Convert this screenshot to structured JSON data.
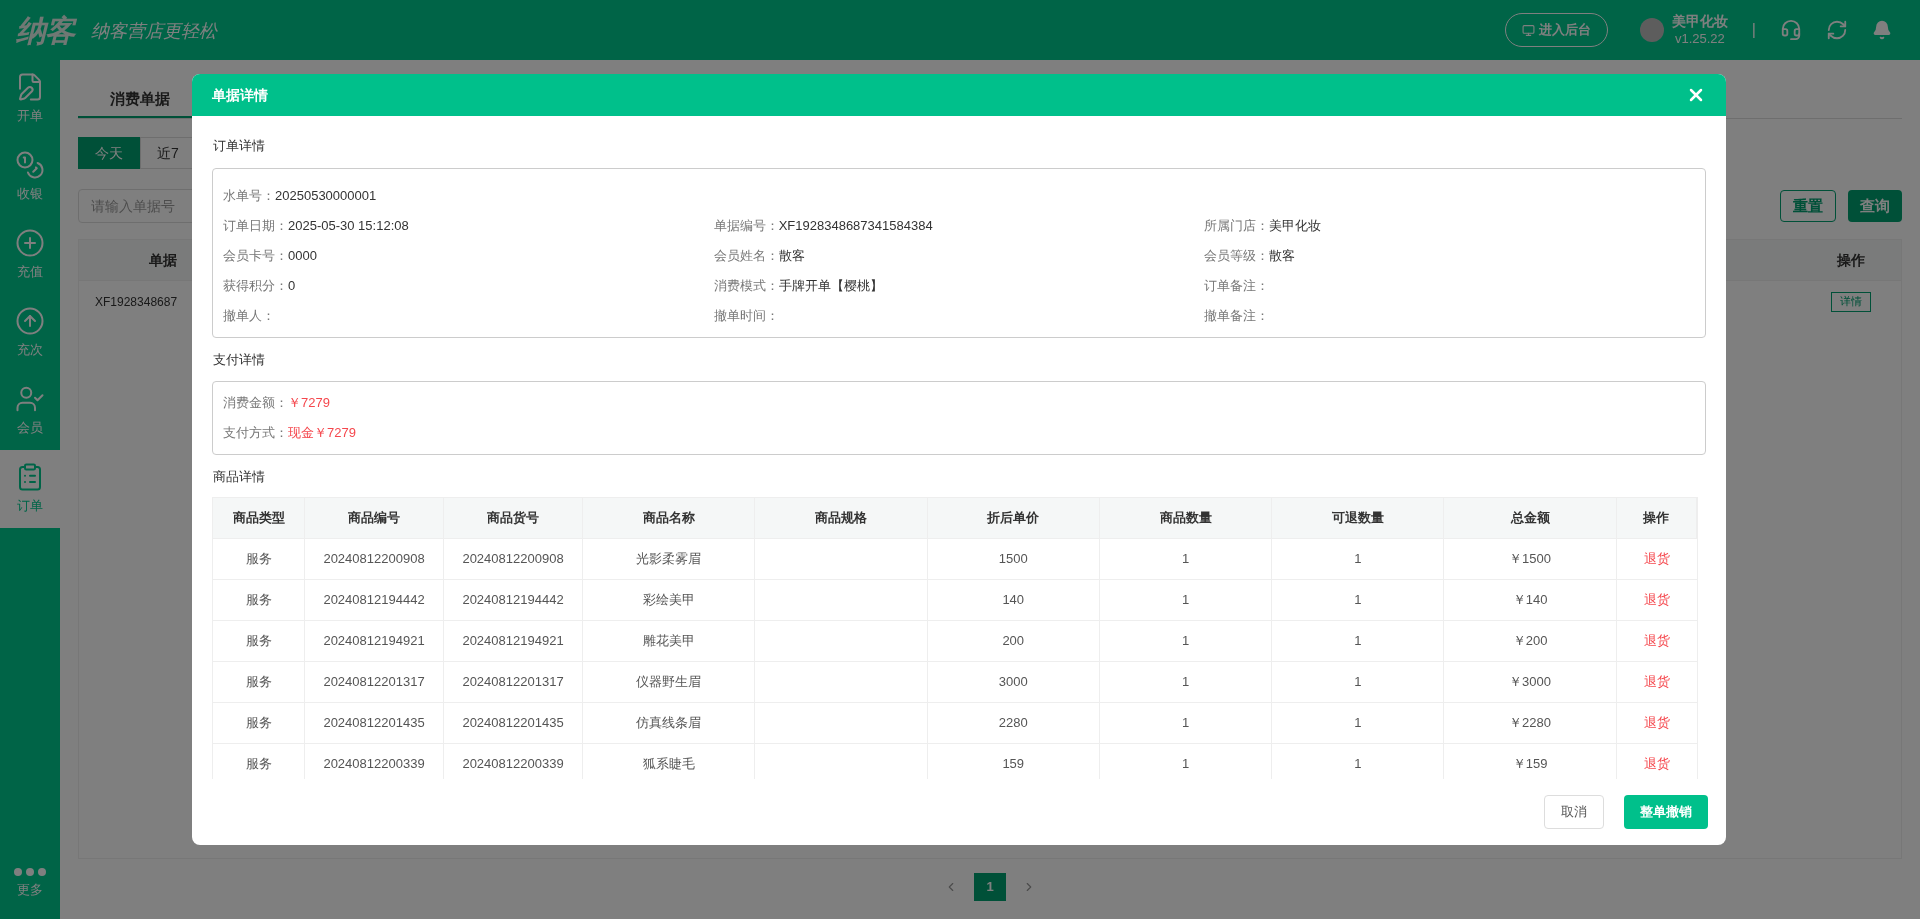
{
  "header": {
    "logo": "纳客",
    "slogan": "纳客营店更轻松",
    "admin_button": "进入后台",
    "store_name": "美甲化妆",
    "version": "v1.25.22",
    "separator": "|"
  },
  "sidebar": {
    "items": [
      {
        "label": "开单",
        "selected": false
      },
      {
        "label": "收银",
        "selected": false
      },
      {
        "label": "充值",
        "selected": false
      },
      {
        "label": "充次",
        "selected": false
      },
      {
        "label": "会员",
        "selected": false
      },
      {
        "label": "订单",
        "selected": true
      }
    ],
    "more": "更多"
  },
  "page": {
    "tabs": [
      {
        "label": "消费单据",
        "selected": true
      }
    ],
    "date_filters": [
      {
        "label": "今天",
        "selected": true
      },
      {
        "label": "近7",
        "selected": false
      }
    ],
    "search": {
      "placeholder": "请输入单据号"
    },
    "reset_button": "重置",
    "query_button": "查询",
    "table": {
      "columns": [
        "单据",
        "操作"
      ],
      "rows": [
        {
          "cells": [
            "XF1928348687"
          ],
          "action": "详情"
        }
      ]
    },
    "pagination": {
      "pages": [
        {
          "label": "1",
          "selected": true
        }
      ]
    }
  },
  "dialog": {
    "title": "单据详情",
    "order_section": {
      "title": "订单详情",
      "serial": {
        "label": "水单号：",
        "value": "20250530000001"
      },
      "fields": [
        {
          "label": "订单日期：",
          "value": "2025-05-30 15:12:08"
        },
        {
          "label": "单据编号：",
          "value": "XF1928348687341584384"
        },
        {
          "label": "所属门店：",
          "value": "美甲化妆"
        },
        {
          "label": "会员卡号：",
          "value": "0000"
        },
        {
          "label": "会员姓名：",
          "value": "散客"
        },
        {
          "label": "会员等级：",
          "value": "散客"
        },
        {
          "label": "获得积分：",
          "value": "0"
        },
        {
          "label": "消费模式：",
          "value": "手牌开单【樱桃】"
        },
        {
          "label": "订单备注："
        },
        {
          "label": "撤单人："
        },
        {
          "label": "撤单时间："
        },
        {
          "label": "撤单备注："
        }
      ]
    },
    "payment_section": {
      "title": "支付详情",
      "fields": [
        {
          "label": "消费金额：",
          "value": "￥7279"
        },
        {
          "label": "支付方式：",
          "value": "现金￥7279"
        }
      ]
    },
    "goods_section": {
      "title": "商品详情",
      "columns": [
        "商品类型",
        "商品编号",
        "商品货号",
        "商品名称",
        "商品规格",
        "折后单价",
        "商品数量",
        "可退数量",
        "总金额",
        "操作"
      ],
      "rows": [
        {
          "cells": [
            "服务",
            "20240812200908",
            "20240812200908",
            "光影柔雾眉",
            "",
            "1500",
            "1",
            "1",
            "￥1500"
          ],
          "action": "退货"
        },
        {
          "cells": [
            "服务",
            "20240812194442",
            "20240812194442",
            "彩绘美甲",
            "",
            "140",
            "1",
            "1",
            "￥140"
          ],
          "action": "退货"
        },
        {
          "cells": [
            "服务",
            "20240812194921",
            "20240812194921",
            "雕花美甲",
            "",
            "200",
            "1",
            "1",
            "￥200"
          ],
          "action": "退货"
        },
        {
          "cells": [
            "服务",
            "20240812201317",
            "20240812201317",
            "仪器野生眉",
            "",
            "3000",
            "1",
            "1",
            "￥3000"
          ],
          "action": "退货"
        },
        {
          "cells": [
            "服务",
            "20240812201435",
            "20240812201435",
            "仿真线条眉",
            "",
            "2280",
            "1",
            "1",
            "￥2280"
          ],
          "action": "退货"
        },
        {
          "cells": [
            "服务",
            "20240812200339",
            "20240812200339",
            "狐系睫毛",
            "",
            "159",
            "1",
            "1",
            "￥159"
          ],
          "action": "退货"
        }
      ]
    },
    "cancel_button": "取消",
    "revoke_button": "整单撤销"
  }
}
